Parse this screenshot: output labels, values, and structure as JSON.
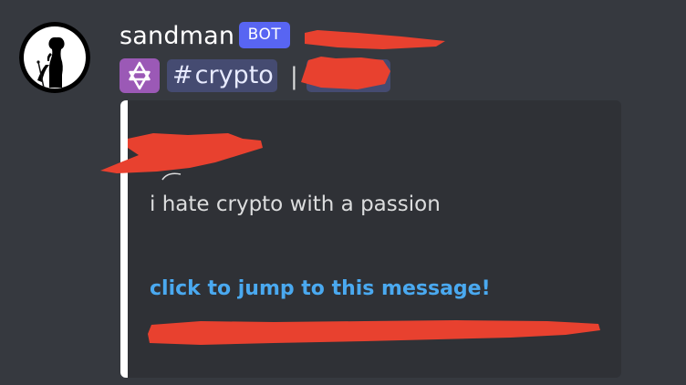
{
  "message": {
    "author": "sandman",
    "bot_tag": "BOT",
    "star_icon": "star-of-david-icon",
    "channel": {
      "hash": "#",
      "name": "crypto"
    },
    "separator": "|",
    "quote": "i hate crypto with a passion",
    "jump_link": "click to jump to this message!"
  },
  "colors": {
    "background": "#36393f",
    "embed_background": "#2f3136",
    "embed_accent_bar": "#ffffff",
    "bot_tag": "#5865f2",
    "star_badge": "#9b59b6",
    "channel_pill": "#454b71",
    "link": "#4aa9f0",
    "redaction": "#e8412f"
  }
}
